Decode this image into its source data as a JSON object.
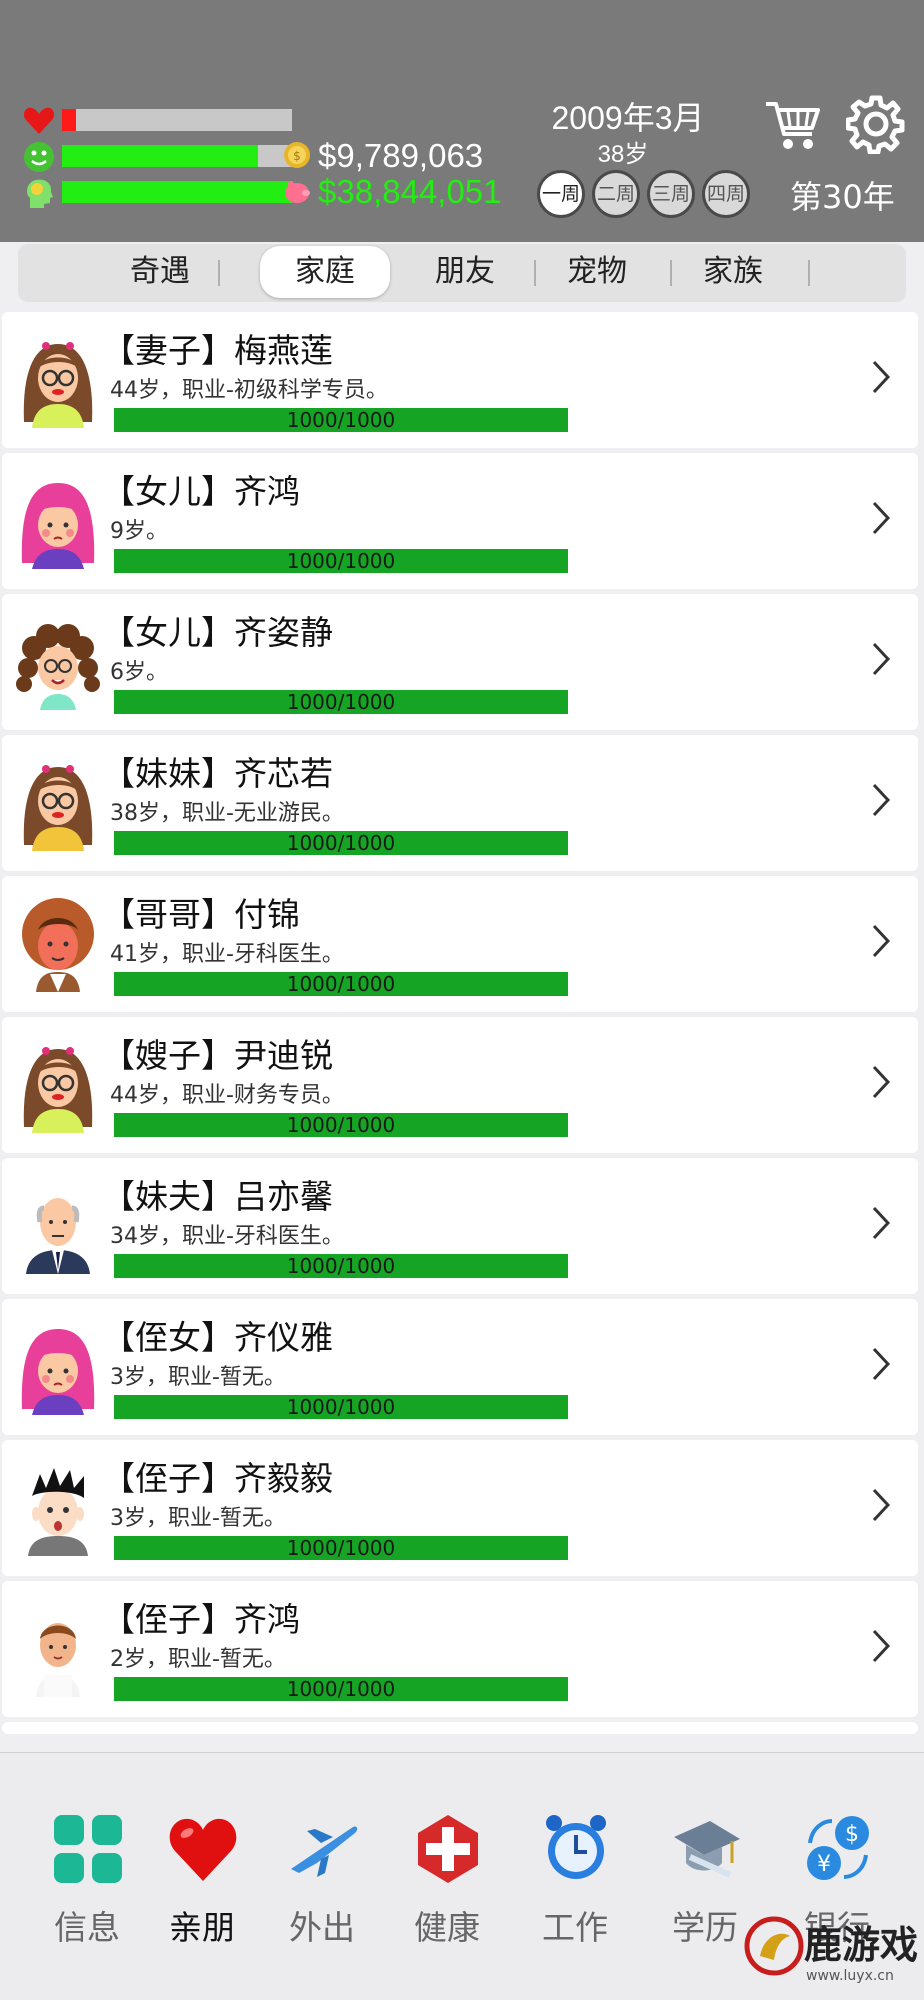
{
  "status": {
    "health": 0.06,
    "happiness": 0.85,
    "intelligence": 1.0,
    "colors": {
      "health": "#ff1a1a",
      "happiness": "#22ee11",
      "intelligence": "#22ee11",
      "bar_bg": "#c8c8c8"
    }
  },
  "money": {
    "cash": "$9,789,063",
    "assets": "$38,844,051",
    "cash_color": "#ffffff",
    "assets_color": "#22ee11"
  },
  "date": {
    "text": "2009年3月",
    "age": "38岁"
  },
  "weeks": [
    "一周",
    "二周",
    "三周",
    "四周"
  ],
  "year_label": "第30年",
  "tabs": [
    "奇遇",
    "家庭",
    "朋友",
    "宠物",
    "家族"
  ],
  "active_tab": "家庭",
  "members": [
    {
      "title": "【妻子】梅燕莲",
      "desc": "44岁，职业-初级科学专员。",
      "progress": "1000/1000",
      "avatar": "woman-glasses-avatar"
    },
    {
      "title": "【女儿】齐鸿",
      "desc": "9岁。",
      "progress": "1000/1000",
      "avatar": "pink-hair-girl-avatar"
    },
    {
      "title": "【女儿】齐姿静",
      "desc": "6岁。",
      "progress": "1000/1000",
      "avatar": "curly-hair-girl-avatar"
    },
    {
      "title": "【妹妹】齐芯若",
      "desc": "38岁，职业-无业游民。",
      "progress": "1000/1000",
      "avatar": "woman-glasses-yellow-avatar"
    },
    {
      "title": "【哥哥】付锦",
      "desc": "41岁，职业-牙科医生。",
      "progress": "1000/1000",
      "avatar": "man-red-face-avatar"
    },
    {
      "title": "【嫂子】尹迪锐",
      "desc": "44岁，职业-财务专员。",
      "progress": "1000/1000",
      "avatar": "woman-glasses-avatar"
    },
    {
      "title": "【妹夫】吕亦馨",
      "desc": "34岁，职业-牙科医生。",
      "progress": "1000/1000",
      "avatar": "bald-man-suit-avatar"
    },
    {
      "title": "【侄女】齐仪雅",
      "desc": "3岁，职业-暂无。",
      "progress": "1000/1000",
      "avatar": "pink-hair-girl-avatar"
    },
    {
      "title": "【侄子】齐毅毅",
      "desc": "3岁，职业-暂无。",
      "progress": "1000/1000",
      "avatar": "spiky-hair-boy-avatar"
    },
    {
      "title": "【侄子】齐鸿",
      "desc": "2岁，职业-暂无。",
      "progress": "1000/1000",
      "avatar": "little-boy-avatar"
    }
  ],
  "nav": [
    {
      "label": "信息",
      "icon": "info-grid-icon"
    },
    {
      "label": "亲朋",
      "icon": "heart-icon"
    },
    {
      "label": "外出",
      "icon": "airplane-icon"
    },
    {
      "label": "健康",
      "icon": "medical-cross-icon"
    },
    {
      "label": "工作",
      "icon": "alarm-clock-icon"
    },
    {
      "label": "学历",
      "icon": "graduation-cap-icon"
    },
    {
      "label": "银行",
      "icon": "currency-exchange-icon"
    }
  ],
  "active_nav": "亲朋",
  "watermark": {
    "text": "鹿游戏",
    "url": "www.luyx.cn"
  }
}
